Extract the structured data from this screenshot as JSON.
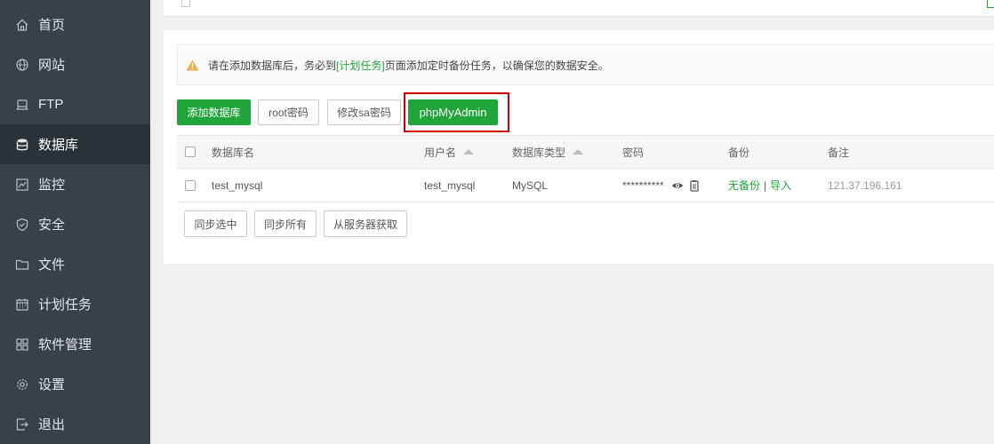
{
  "sidebar": {
    "items": [
      {
        "label": "首页",
        "icon": "home-icon"
      },
      {
        "label": "网站",
        "icon": "globe-icon"
      },
      {
        "label": "FTP",
        "icon": "ftp-icon"
      },
      {
        "label": "数据库",
        "icon": "database-icon",
        "active": true
      },
      {
        "label": "监控",
        "icon": "monitor-icon"
      },
      {
        "label": "安全",
        "icon": "shield-icon"
      },
      {
        "label": "文件",
        "icon": "folder-icon"
      },
      {
        "label": "计划任务",
        "icon": "calendar-icon"
      },
      {
        "label": "软件管理",
        "icon": "apps-icon"
      },
      {
        "label": "设置",
        "icon": "gear-icon"
      },
      {
        "label": "退出",
        "icon": "logout-icon"
      }
    ]
  },
  "notice": {
    "before": "请在添加数据库后，务必到",
    "link": "[计划任务]",
    "after": "页面添加定时备份任务，以确保您的数据安全。"
  },
  "toolbar": {
    "add_db": "添加数据库",
    "root_pw": "root密码",
    "sa_pw": "修改sa密码",
    "phpmyadmin": "phpMyAdmin"
  },
  "table": {
    "headers": {
      "name": "数据库名",
      "user": "用户名",
      "type": "数据库类型",
      "password": "密码",
      "backup": "备份",
      "remark": "备注"
    },
    "rows": [
      {
        "name": "test_mysql",
        "user": "test_mysql",
        "type": "MySQL",
        "password": "**********",
        "backup_none": "无备份",
        "separator": "|",
        "import": "导入",
        "remark": "121.37.196.161"
      }
    ]
  },
  "sync": {
    "selected": "同步选中",
    "all": "同步所有",
    "from_server": "从服务器获取"
  },
  "colors": {
    "sidebar": "#374149",
    "accent": "#20a53a",
    "highlight": "#cc0000"
  }
}
